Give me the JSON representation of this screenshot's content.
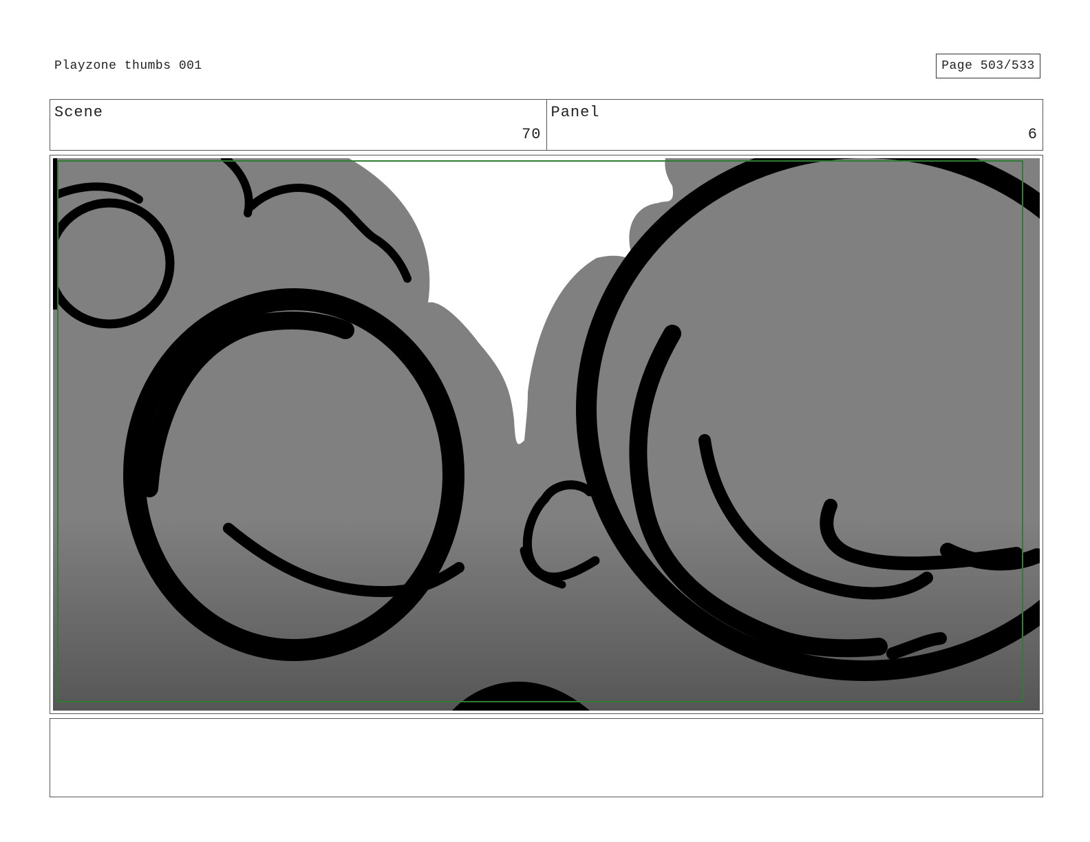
{
  "header": {
    "document_title": "Playzone thumbs 001",
    "page_label": "Page 503/533"
  },
  "info": {
    "scene_label": "Scene",
    "scene_value": "70",
    "panel_label": "Panel",
    "panel_value": "6"
  },
  "frame": {
    "safe_area_color": "#2e7d32",
    "fill_gray": "#808080",
    "line_color": "#000000"
  },
  "notes": {
    "text": ""
  }
}
